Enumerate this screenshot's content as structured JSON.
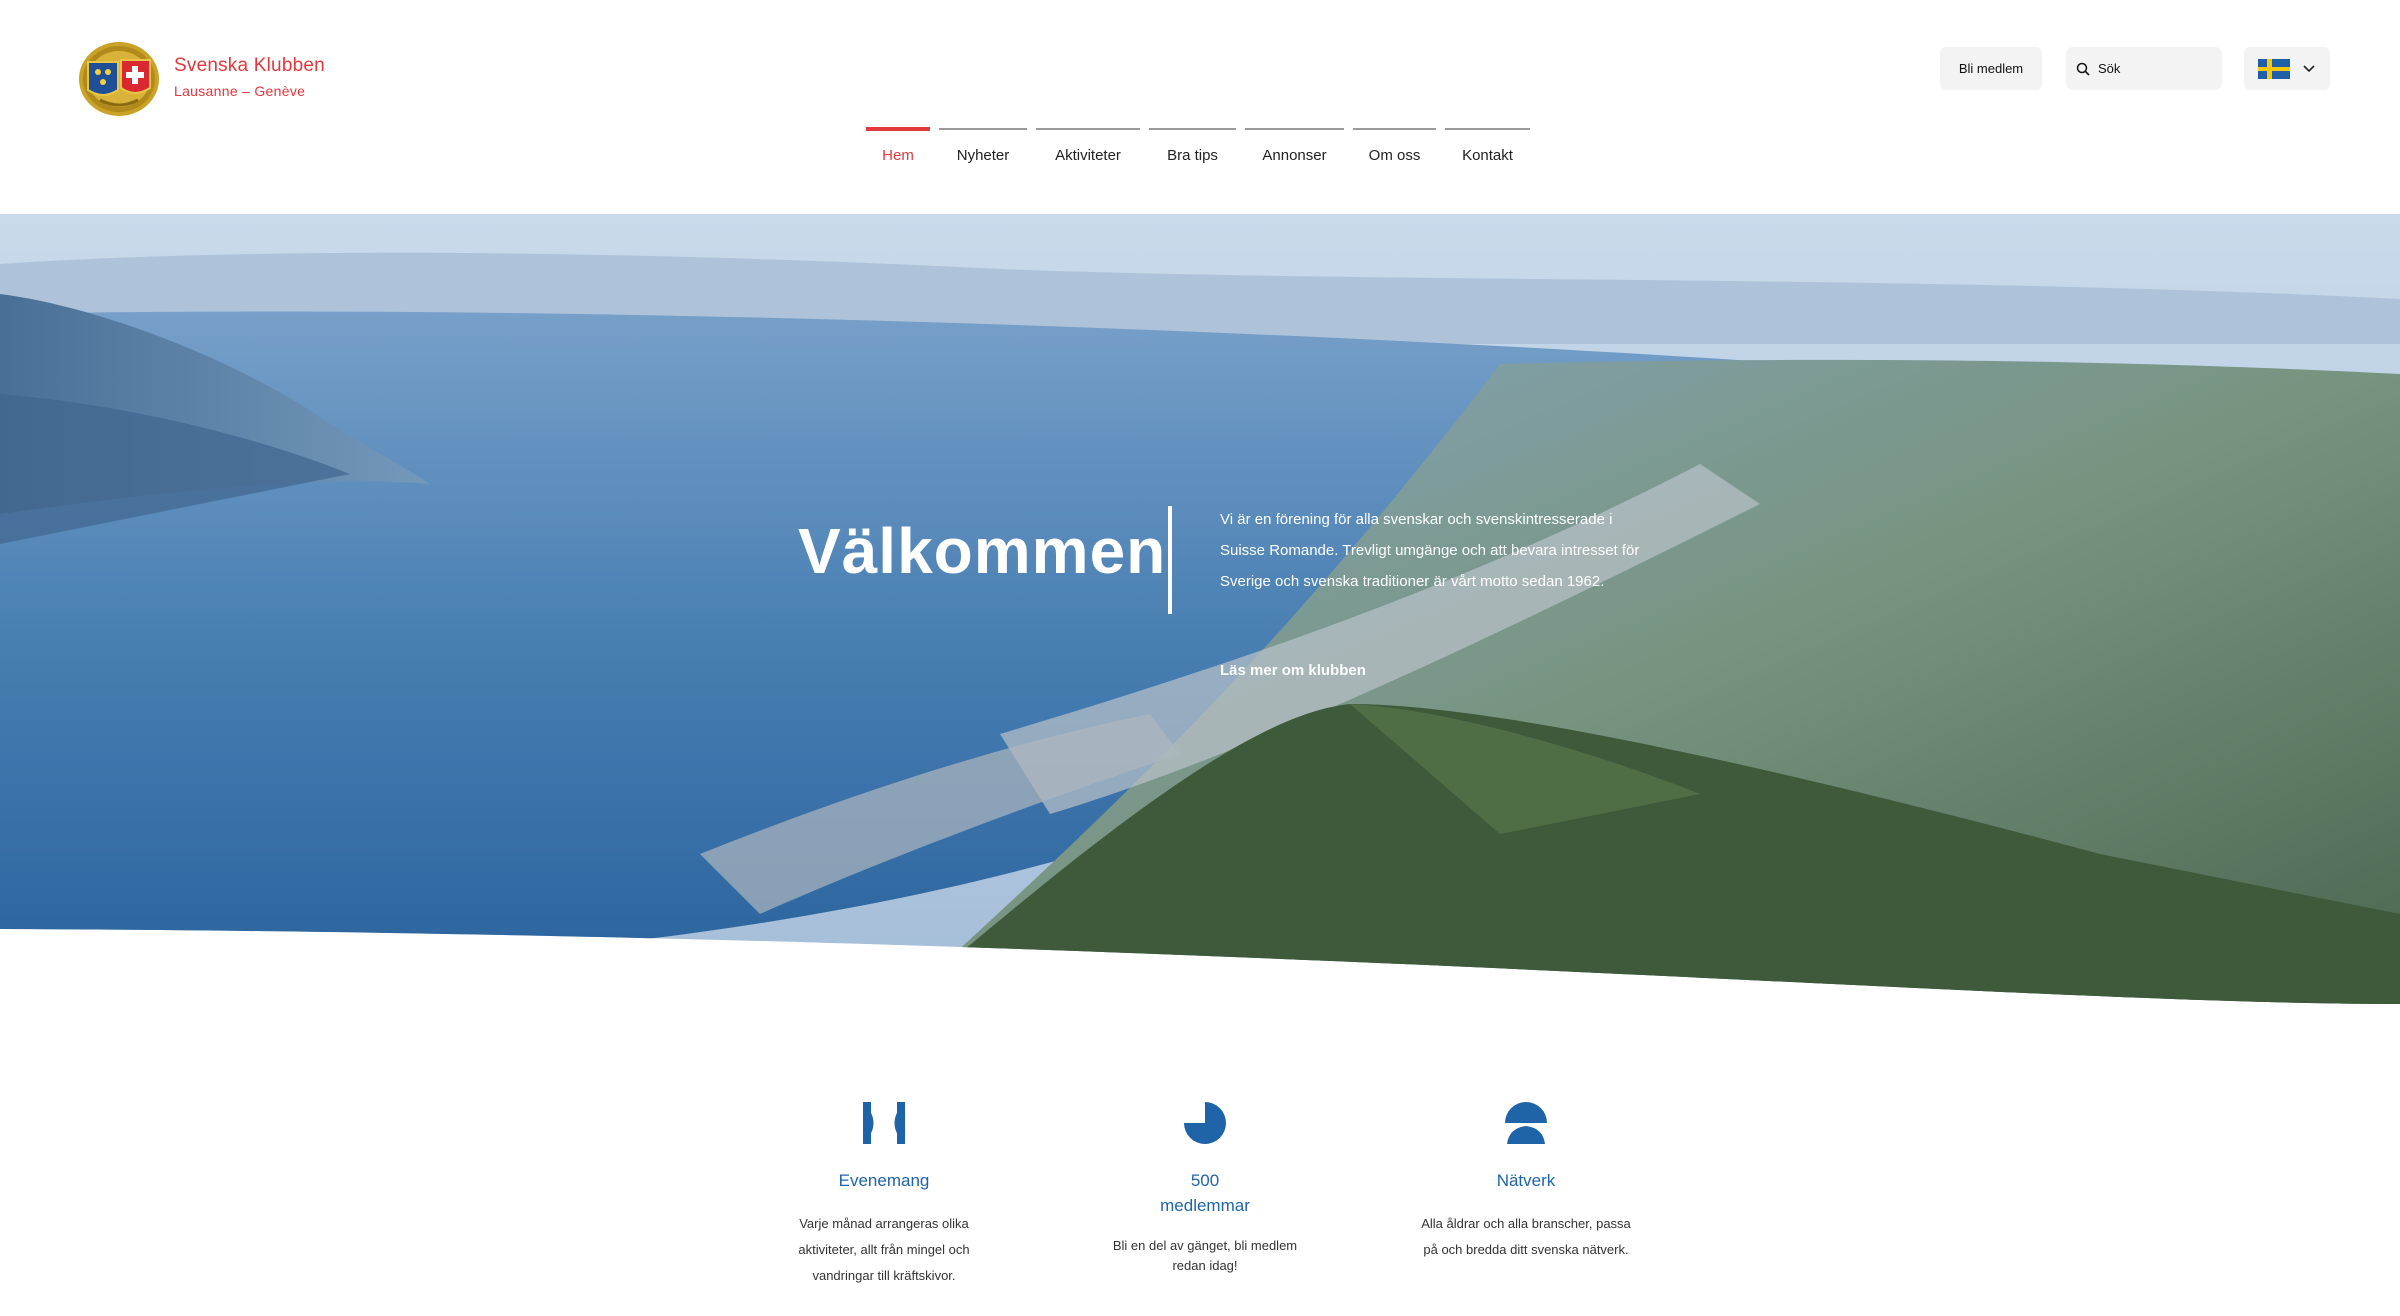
{
  "header": {
    "brand_name": "Svenska Klubben",
    "brand_sub": "Lausanne – Genève",
    "join_label": "Bli medlem",
    "search_placeholder": "Sök",
    "language_flag": "swedish-flag-icon"
  },
  "nav": {
    "items": [
      {
        "label": "Hem",
        "active": true
      },
      {
        "label": "Nyheter",
        "active": false
      },
      {
        "label": "Aktiviteter",
        "active": false
      },
      {
        "label": "Bra tips",
        "active": false
      },
      {
        "label": "Annonser",
        "active": false
      },
      {
        "label": "Om oss",
        "active": false
      },
      {
        "label": "Kontakt",
        "active": false
      }
    ]
  },
  "hero": {
    "title": "Välkommen",
    "text": "Vi är en förening för alla svenskar och svenskintresserade i Suisse Romande. Trevligt umgänge och att bevara intresset för Sverige och svenska traditioner är vårt motto sedan 1962.",
    "link": "Läs mer om klubben"
  },
  "features": [
    {
      "icon": "bow-tie-icon",
      "title": "Evenemang",
      "desc": "Varje månad arrangeras olika aktiviteter, allt från mingel och vandringar till kräftskivor."
    },
    {
      "icon": "pie-icon",
      "title": "500 medlemmar",
      "desc": "Bli en del av gänget, bli medlem redan idag!"
    },
    {
      "icon": "people-icon",
      "title": "Nätverk",
      "desc": "Alla åldrar och alla branscher, passa på och bredda ditt svenska nätverk."
    }
  ],
  "colors": {
    "accent_red": "#e0383e",
    "accent_blue": "#1f63a8"
  }
}
